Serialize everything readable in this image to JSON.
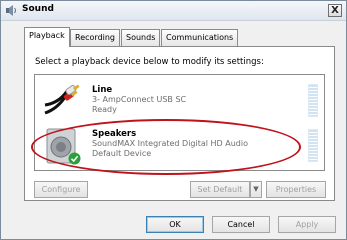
{
  "window": {
    "title": "Sound",
    "close_label": "X"
  },
  "tabs": [
    {
      "label": "Playback"
    },
    {
      "label": "Recording"
    },
    {
      "label": "Sounds"
    },
    {
      "label": "Communications"
    }
  ],
  "panel": {
    "instruction": "Select a playback device below to modify its settings:"
  },
  "devices": [
    {
      "name": "Line",
      "detail": "3- AmpConnect USB SC",
      "status": "Ready",
      "icon": "rca-cable-icon"
    },
    {
      "name": "Speakers",
      "detail": "SoundMAX Integrated Digital HD Audio",
      "status": "Default Device",
      "icon": "speaker-icon",
      "default_badge": "check-icon"
    }
  ],
  "buttons": {
    "configure": "Configure",
    "set_default": "Set Default",
    "properties": "Properties",
    "ok": "OK",
    "cancel": "Cancel",
    "apply": "Apply"
  },
  "colors": {
    "highlight": "#c0121a",
    "default_check": "#2aa23a"
  }
}
